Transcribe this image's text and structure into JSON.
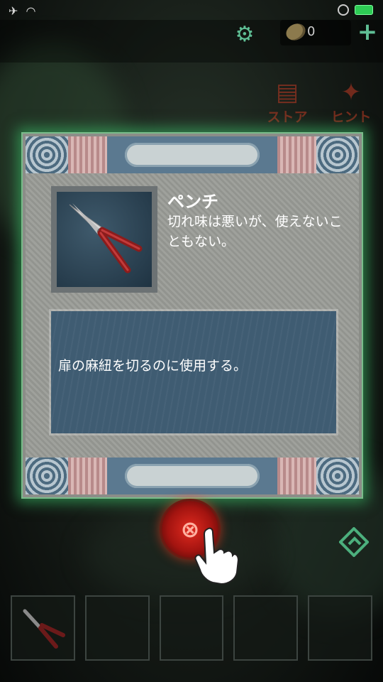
{
  "status_bar": {
    "icons": [
      "airplane-icon",
      "wifi-icon",
      "battery-icon"
    ]
  },
  "top_bar": {
    "coin_count": "0",
    "settings_icon": "gear-icon",
    "add_icon": "plus-icon"
  },
  "menu": {
    "store_label": "ストア",
    "hint_label": "ヒント"
  },
  "item_detail": {
    "name": "ペンチ",
    "description": "切れ味は悪いが、使えないこともない。",
    "usage": "扉の麻紐を切るのに使用する。"
  },
  "close_button": {
    "icon": "close-icon"
  },
  "inventory": {
    "slots": [
      {
        "item": "pliers"
      },
      {
        "item": ""
      },
      {
        "item": ""
      },
      {
        "item": ""
      },
      {
        "item": ""
      }
    ]
  },
  "colors": {
    "accent_green": "#5fbf95",
    "close_red": "#e02a1f",
    "panel_blue": "#3f5c72"
  }
}
